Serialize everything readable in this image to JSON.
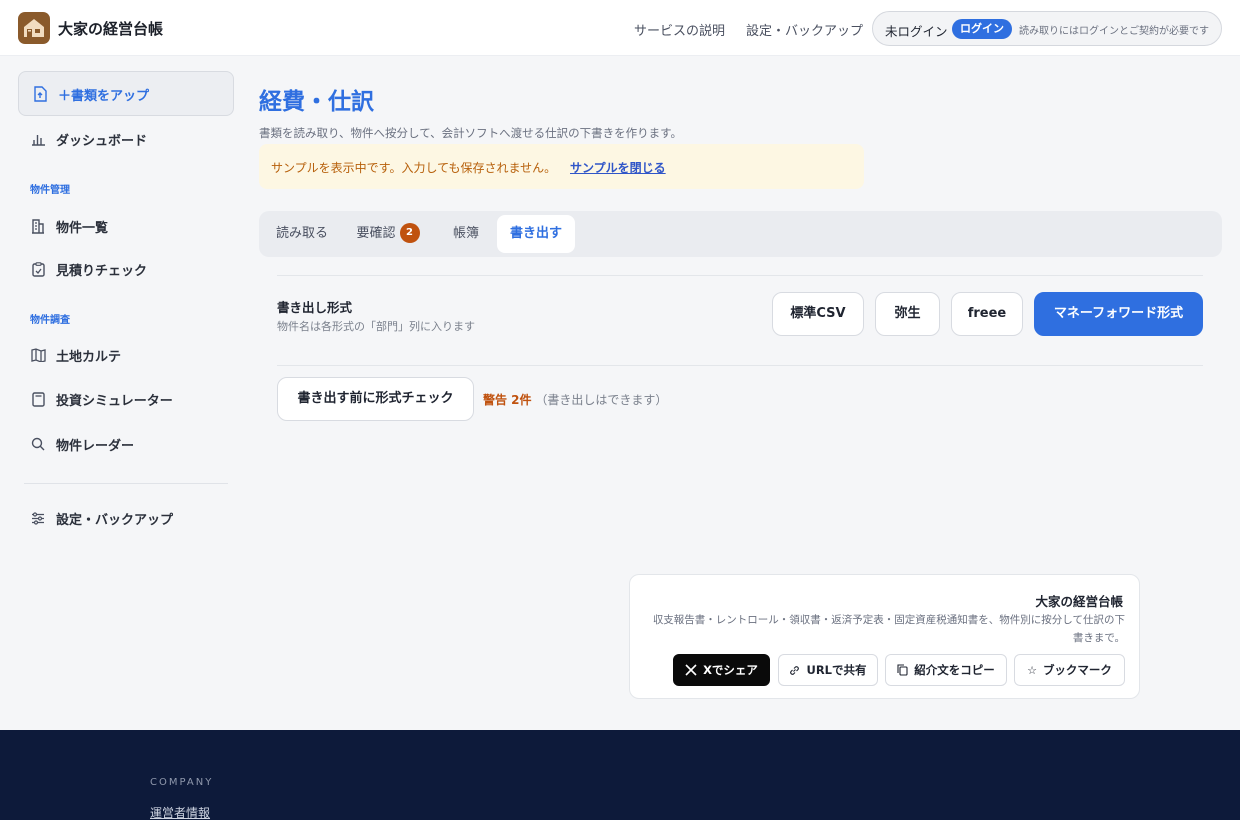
{
  "header": {
    "app_name": "大家の経営台帳",
    "nav": [
      "サービスの説明",
      "設定・バックアップ"
    ],
    "login_status": "未ログイン",
    "login_button": "ログイン",
    "login_note": "読み取りにはログインとご契約が必要です"
  },
  "sidebar": {
    "upload_label": "＋書類をアップ",
    "dashboard_label": "ダッシュボード",
    "group_property_mgmt": "物件管理",
    "property_list": "物件一覧",
    "estimate_check": "見積りチェック",
    "group_property_research": "物件調査",
    "land_chart": "土地カルテ",
    "investment_sim": "投資シミュレーター",
    "property_radar": "物件レーダー",
    "settings": "設定・バックアップ"
  },
  "main": {
    "title": "経費・仕訳",
    "description": "書類を読み取り、物件へ按分して、会計ソフトへ渡せる仕訳の下書きを作ります。",
    "notice_text": "サンプルを表示中です。入力しても保存されません。",
    "notice_link": "サンプルを閉じる",
    "tabs": [
      {
        "label": "読み取る"
      },
      {
        "label": "要確認",
        "badge": "2"
      },
      {
        "label": "帳簿"
      },
      {
        "label": "書き出す"
      }
    ],
    "export_format_title": "書き出し形式",
    "export_format_sub": "物件名は各形式の「部門」列に入ります",
    "formats": [
      "標準CSV",
      "弥生",
      "freee",
      "マネーフォワード形式"
    ],
    "selected_format": "マネーフォワード形式",
    "check_button": "書き出す前に形式チェック",
    "warning_label": "警告 2件",
    "warning_note": "（書き出しはできます）"
  },
  "share": {
    "title": "大家の経営台帳",
    "description": "収支報告書・レントロール・領収書・返済予定表・固定資産税通知書を、物件別に按分して仕訳の下書きまで。",
    "buttons": [
      "Xでシェア",
      "URLで共有",
      "紹介文をコピー",
      "ブックマーク"
    ]
  },
  "footer": {
    "section_label": "COMPANY",
    "link": "運営者情報"
  },
  "colors": {
    "accent": "#2f6fe0",
    "warning": "#c0520f",
    "footer_bg": "#0d1a3a",
    "logo_bg": "#8a5a2b"
  }
}
